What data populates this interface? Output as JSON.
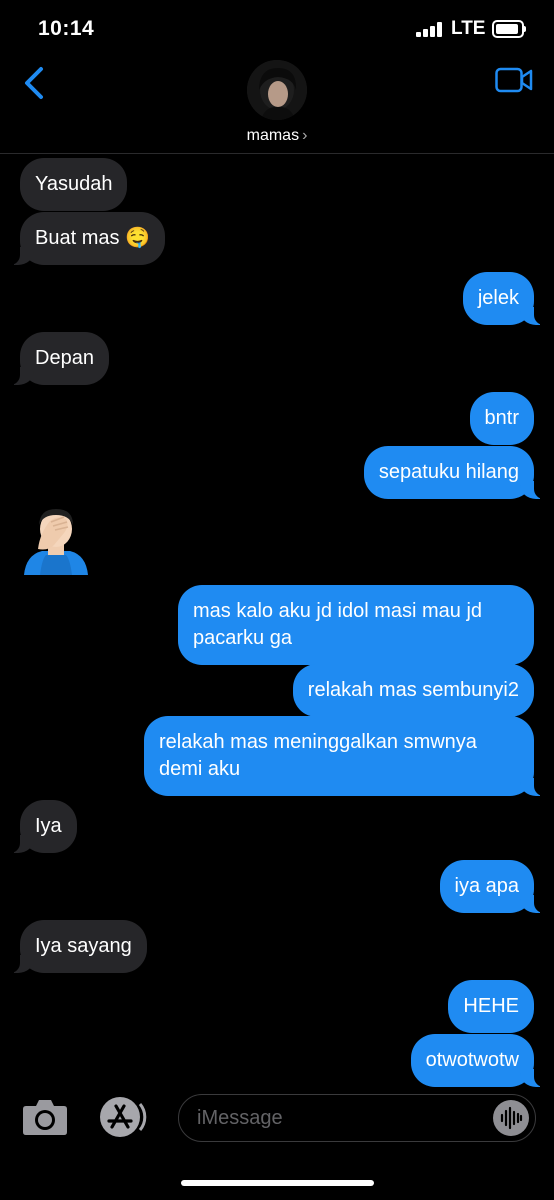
{
  "status": {
    "time": "10:14",
    "carrier": "LTE"
  },
  "header": {
    "contact_name": "mamas",
    "chevron": "›"
  },
  "messages": [
    {
      "text": "Yasudah"
    },
    {
      "text": "Buat mas 🤤"
    },
    {
      "text": "jelek"
    },
    {
      "text": "Depan"
    },
    {
      "text": "bntr"
    },
    {
      "text": "sepatuku hilang"
    },
    {
      "text": "🤦🏻‍♂️"
    },
    {
      "text": "mas kalo aku jd idol masi mau jd pacarku ga"
    },
    {
      "text": "relakah mas sembunyi2"
    },
    {
      "text": "relakah mas meninggalkan smwnya demi aku"
    },
    {
      "text": "Iya"
    },
    {
      "text": "iya apa"
    },
    {
      "text": "Iya sayang"
    },
    {
      "text": "HEHE"
    },
    {
      "text": "otwotwotw"
    }
  ],
  "input": {
    "placeholder": "iMessage"
  },
  "icons": {
    "back": "chevron-left-icon",
    "video": "video-camera-icon",
    "camera": "camera-icon",
    "apps": "app-store-icon",
    "audio": "audio-waveform-icon"
  },
  "colors": {
    "accent": "#1f8bf2",
    "incoming_bubble": "#262629",
    "background": "#000000"
  }
}
